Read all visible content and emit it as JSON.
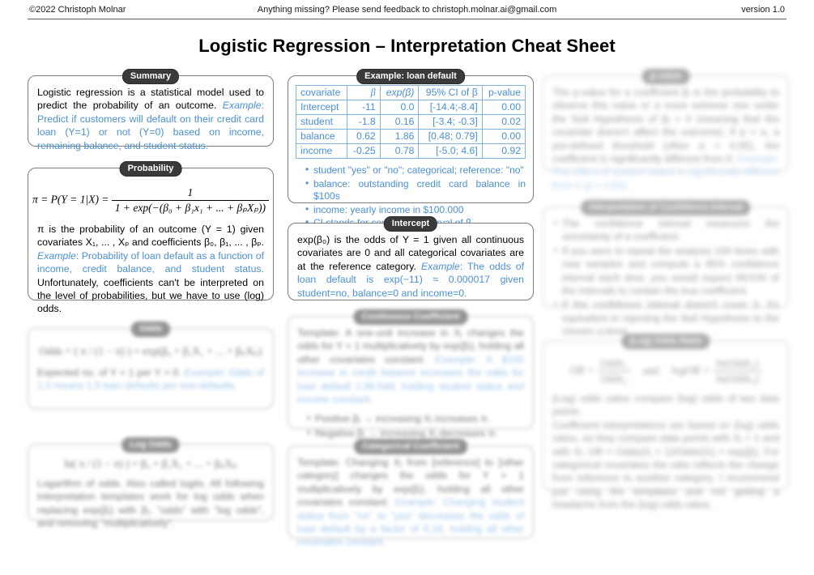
{
  "header": {
    "copyright": "©2022 Christoph Molnar",
    "feedback": "Anything missing? Please send feedback to christoph.molnar.ai@gmail.com",
    "version": "version 1.0"
  },
  "title": "Logistic Regression – Interpretation Cheat Sheet",
  "summary": {
    "pill": "Summary",
    "text_black_1": "Logistic regression is a statistical model used to predict the probability of an outcome. ",
    "example_label": "Example",
    "text_blue_1": ": Predict if customers will default on their credit card loan (Y=1) or not (Y=0) based on income, remaining balance, and student status."
  },
  "probability": {
    "pill": "Probability",
    "formula": {
      "lhs": "π = P(Y = 1|X) =",
      "numerator": "1",
      "denominator": "1 + exp(−(β₀ + β₁x₁ + ... + βₚXₚ))"
    },
    "text_1": "π is the probability of an outcome (Y = 1) given covariates X₁, ... , Xₚ and coefficients β₀, β₁, ... , βₚ. ",
    "example_label": "Example",
    "text_blue": ": Probability of loan default as a function of income, credit balance, and student status.",
    "text_2": " Unfortunately, coefficients can't be interpreted on the level of probabilities, but we have to use (log) odds."
  },
  "odds": {
    "pill": "Odds",
    "formula": "Odds = ( π / (1 − π) ) = exp(β₀ + β₁X₁ + ... + βₚXₚ)",
    "text_1": "Expected no. of Y = 1 per Y = 0. ",
    "example_label": "Example",
    "text_blue": ": Odds of 1.5 means 1.5 loan defaults per non-defaults."
  },
  "log_odds": {
    "pill": "Log Odds",
    "formula": "ln( π / (1 − π) ) = β₀ + β₁X₁ + ... + βₚXₚ",
    "text": "Logarithm of odds. Also called logits. All following interpretation templates work for log odds when replacing exp(βⱼ) with βⱼ, \"odds\" with \"log odds\", and removing \"multiplicatively\"."
  },
  "example_table": {
    "pill": "Example: loan default",
    "columns": [
      "covariate",
      "β",
      "exp(β)",
      "95% CI of β",
      "p-value"
    ],
    "rows": [
      [
        "Intercept",
        "-11",
        "0.0",
        "[-14.4;-8.4]",
        "0.00"
      ],
      [
        "student",
        "-1.8",
        "0.16",
        "[-3.4; -0.3]",
        "0.02"
      ],
      [
        "balance",
        "0.62",
        "1.86",
        "[0.48; 0.79]",
        "0.00"
      ],
      [
        "income",
        "-0.25",
        "0.78",
        "[-5.0; 4.6]",
        "0.92"
      ]
    ],
    "bullets": [
      "student \"yes\" or \"no\"; categorical; reference: \"no\"",
      "balance: outstanding credit card balance in $100s",
      "income: yearly income in $100.000",
      "CI stands for confidence interval of β"
    ]
  },
  "intercept": {
    "pill": "Intercept",
    "text_1": "exp(β₀) is the odds of Y = 1 given all continuous covariates are 0 and all categorical covariates are at the reference category. ",
    "example_label": "Example",
    "text_blue": ": The odds of loan default is exp(−11) ≈ 0.000017 given student=no, balance=0 and income=0."
  },
  "continuous_coefficient": {
    "pill": "Continuous Coefficient",
    "text_1": "Template: A one-unit increase in Xⱼ changes the odds for Y = 1 multiplicatively by exp(βⱼ), holding all other covariates constant. ",
    "example_label": "Example",
    "text_blue": ": A $100 increase in credit balance increases the odds for loan default 1.86-fold, holding student status and income constant.",
    "bullets": [
      "Positive βⱼ → increasing Xⱼ increases π.",
      "Negative βⱼ → increasing Xⱼ decreases π."
    ]
  },
  "categorical_coefficient": {
    "pill": "Categorical Coefficient",
    "text_1": "Template: Changing Xⱼ from [reference] to [other category] changes the odds for Y = 1 multiplicatively by exp(βⱼ), holding all other covariates constant. ",
    "example_label": "Example",
    "text_blue": ": Changing student status from \"no\" to \"yes\" decreases the odds of loan default by a factor of 0.16, holding all other covariates constant."
  },
  "p_value": {
    "pill": "p-value",
    "text_1": "The p-value for a coefficient βⱼ is the probability to observe this value or a more extreme one under the Null Hypothesis of βⱼ = 0 (meaning that the covariate doesn't affect the outcome).",
    "text_2": "If p < α, a pre-defined threshold (often α = 0.05), the coefficient is significantly different from 0. ",
    "example_label": "Example",
    "text_blue": ": The effect of student status is significantly different from 0 (p = 0.02)."
  },
  "confidence_interval": {
    "pill": "Interpretation of Confidence Interval",
    "bullets": [
      "The confidence interval measures the uncertainty of a coefficient.",
      "If you were to repeat the analysis 100 times with new samples and compute a 95% confidence interval each time, you would expect 95/100 of the intervals to contain the true coefficient.",
      "If the confidence interval doesn't cover 0, it's equivalent to rejecting the Null Hypothesis to the chosen α-level."
    ]
  },
  "odds_ratio": {
    "pill": "(Log) Odds Ratio",
    "formula_or": "OR =",
    "formula_or_num": "Odds₁",
    "formula_or_den": "Odds₂",
    "formula_and": "and",
    "formula_logor": "logOR =",
    "formula_logor_num": "ln(Odds₁)",
    "formula_logor_den": "ln(Odds₂)",
    "text_1": "(Log) odds ratios compare (log) odds of two data points.",
    "text_2": "Coefficient interpretations are based on (log) odds ratios, as they compare data points with Xⱼ + 1 and with Xⱼ: OR = Odds(Xⱼ + 1)/Odds(Xⱼ) = exp(βⱼ). For categorical covariates the ratio reflects the change from reference to another category. I recommend just using the templates and not getting a headache from the (log) odds ratios."
  },
  "colors": {
    "accent_blue": "#4a90d9",
    "pill_bg": "#3a3a3a",
    "box_border": "#7d7d7d"
  }
}
